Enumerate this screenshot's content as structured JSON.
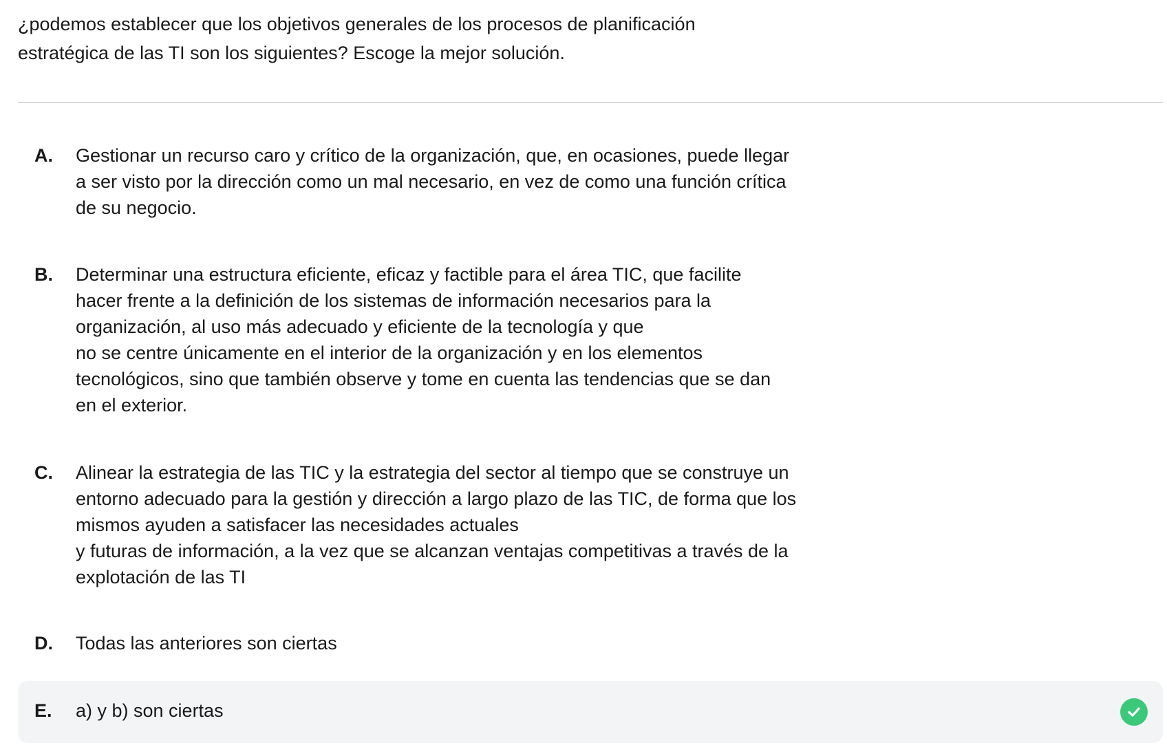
{
  "question": {
    "text": "¿podemos establecer que los objetivos generales de los procesos de planificación\nestratégica de las TI son los siguientes? Escoge la mejor solución."
  },
  "options": [
    {
      "letter": "A.",
      "text": "Gestionar un recurso caro y crítico de la organización, que, en ocasiones, puede llegar\na ser visto por la dirección como un mal necesario, en vez de como una función crítica\nde su negocio."
    },
    {
      "letter": "B.",
      "text": "Determinar una estructura eficiente, eficaz y factible para el área TIC, que facilite\nhacer frente a la definición de los sistemas de información necesarios para la\norganización, al uso más adecuado y eficiente de la tecnología y que\nno se centre únicamente en el interior de la organización y en los elementos\ntecnológicos, sino que también observe y tome en cuenta las tendencias que se dan\nen el exterior."
    },
    {
      "letter": "C.",
      "text": "Alinear la estrategia de las TIC y la estrategia del sector al tiempo que se construye un\nentorno adecuado para la gestión y dirección a largo plazo de las TIC, de forma que los\nmismos ayuden a satisfacer las necesidades actuales\ny futuras de información, a la vez que se alcanzan ventajas competitivas a través de la\nexplotación de las TI"
    },
    {
      "letter": "D.",
      "text": "Todas las anteriores son ciertas"
    },
    {
      "letter": "E.",
      "text": "a) y b) son ciertas",
      "selected": true,
      "status_icon": "check-circle-icon"
    }
  ],
  "colors": {
    "selected_background": "#f3f4f6",
    "correct_green": "#3cc87a",
    "divider": "#d9d9d9"
  }
}
